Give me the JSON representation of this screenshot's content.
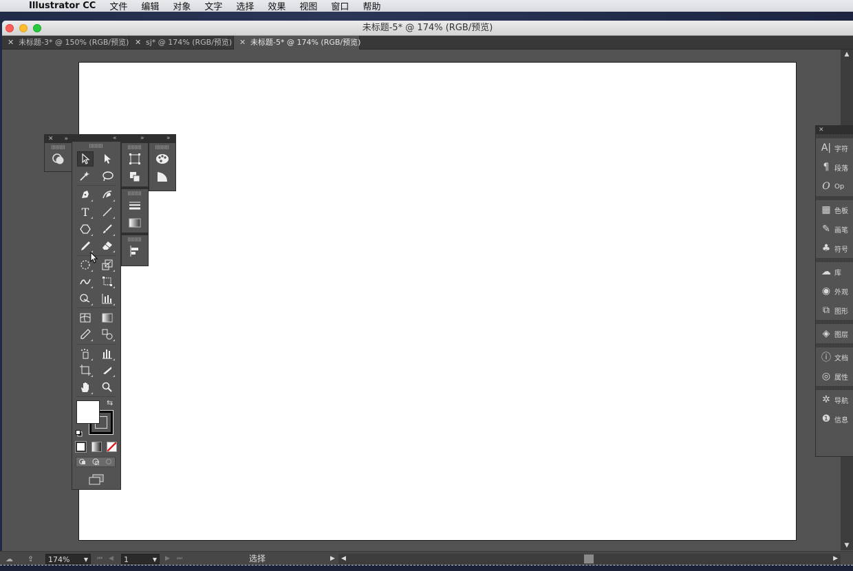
{
  "menubar": {
    "app_name": "Illustrator CC",
    "items": [
      "文件",
      "编辑",
      "对象",
      "文字",
      "选择",
      "效果",
      "视图",
      "窗口",
      "帮助"
    ]
  },
  "window": {
    "title": "未标题-5* @ 174% (RGB/预览)"
  },
  "tabs": [
    {
      "label": "未标题-3* @ 150% (RGB/预览)",
      "active": false
    },
    {
      "label": "sj* @ 174% (RGB/预览)",
      "active": false
    },
    {
      "label": "未标题-5* @ 174% (RGB/预览)",
      "active": true
    }
  ],
  "dock": {
    "items": [
      {
        "icon": "character-icon",
        "label": "字符"
      },
      {
        "icon": "paragraph-icon",
        "label": "段落"
      },
      {
        "icon": "opentype-icon",
        "label": "Op"
      },
      {
        "icon": "swatches-icon",
        "label": "色板"
      },
      {
        "icon": "brushes-icon",
        "label": "画笔"
      },
      {
        "icon": "symbols-icon",
        "label": "符号"
      },
      {
        "icon": "libraries-icon",
        "label": "库"
      },
      {
        "icon": "appearance-icon",
        "label": "外观"
      },
      {
        "icon": "graphic-styles-icon",
        "label": "图形"
      },
      {
        "icon": "layers-icon",
        "label": "图层"
      },
      {
        "icon": "document-info-icon",
        "label": "文档"
      },
      {
        "icon": "attributes-icon",
        "label": "属性"
      },
      {
        "icon": "navigator-icon",
        "label": "导航"
      },
      {
        "icon": "info-icon",
        "label": "信息"
      }
    ]
  },
  "status": {
    "zoom": "174%",
    "artboard_number": "1",
    "tool_name": "选择"
  }
}
